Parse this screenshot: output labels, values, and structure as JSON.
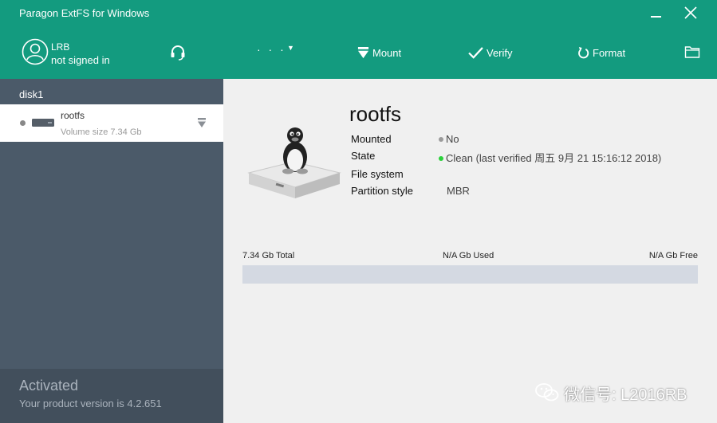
{
  "window": {
    "title": "Paragon ExtFS for Windows"
  },
  "user": {
    "name": "LRB",
    "status": "not signed in"
  },
  "toolbar": {
    "more_label": "· · ·",
    "mount_label": "Mount",
    "verify_label": "Verify",
    "format_label": "Format"
  },
  "sidebar": {
    "disk_label": "disk1",
    "volumes": [
      {
        "name": "rootfs",
        "size": "Volume size 7.34 Gb"
      }
    ],
    "footer": {
      "status": "Activated",
      "version": "Your product version is 4.2.651"
    }
  },
  "volume": {
    "name": "rootfs",
    "properties": [
      {
        "label": "Mounted",
        "value": "No"
      },
      {
        "label": "State",
        "value": "Clean (last verified 周五 9月 21 15:16:12 2018)"
      },
      {
        "label": "File system",
        "value": ""
      },
      {
        "label": "Partition style",
        "value": "MBR"
      }
    ],
    "capacity": {
      "total": "7.34 Gb Total",
      "used": "N/A Gb Used",
      "free": "N/A Gb Free",
      "used_fraction": 0
    }
  },
  "watermark": {
    "text": "微信号: L2016RB"
  },
  "colors": {
    "header": "#139b7f",
    "sidebar": "#4b5a69",
    "status_ok": "#2bd13b",
    "bar": "#d4d9e2"
  }
}
